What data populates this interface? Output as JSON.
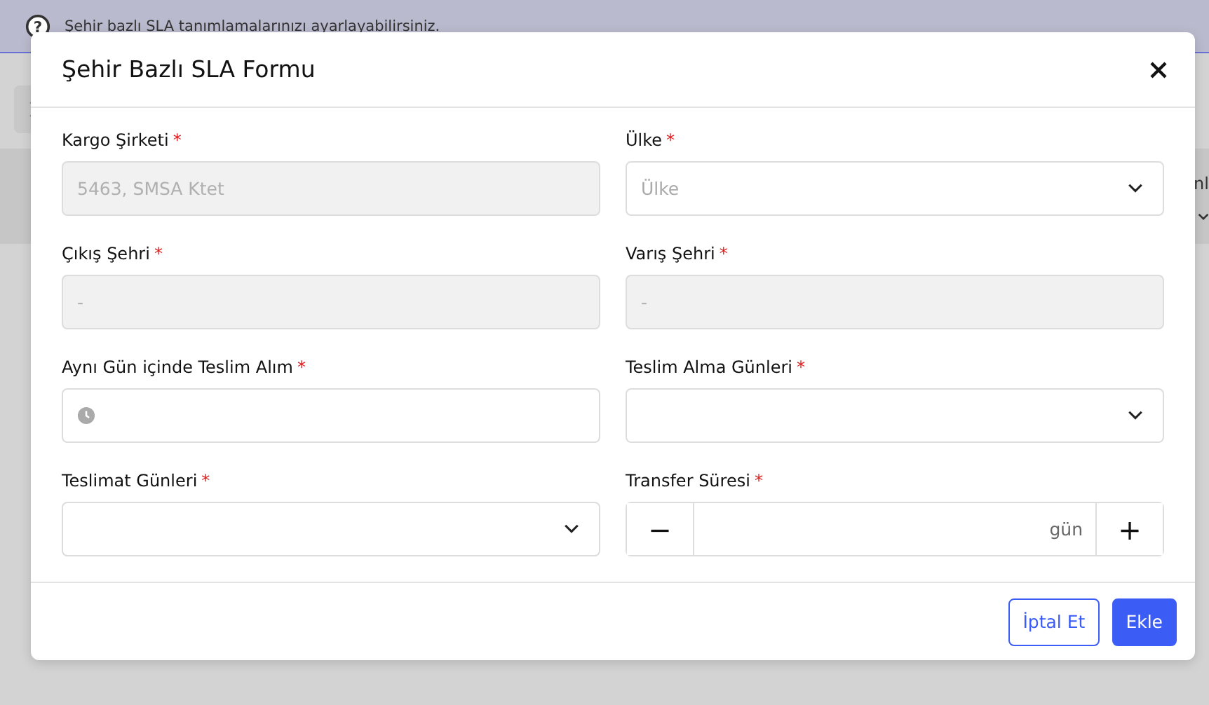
{
  "banner": {
    "icon": "?",
    "text": "Şehir bazlı SLA tanımlamalarınızı ayarlayabilirsiniz."
  },
  "background_fragment": "nl",
  "modal": {
    "title": "Şehir Bazlı SLA Formu",
    "required_mark": "*",
    "fields": [
      {
        "label": "Kargo Şirketi",
        "required": true,
        "kind": "text",
        "disabled": true,
        "value": "5463, SMSA Ktet"
      },
      {
        "label": "Ülke",
        "required": true,
        "kind": "select",
        "disabled": false,
        "placeholder": "Ülke"
      },
      {
        "label": "Çıkış Şehri",
        "required": true,
        "kind": "text",
        "disabled": true,
        "value": "-"
      },
      {
        "label": "Varış Şehri",
        "required": true,
        "kind": "text",
        "disabled": true,
        "value": "-"
      },
      {
        "label": "Aynı Gün içinde Teslim Alım",
        "required": true,
        "kind": "time",
        "disabled": false
      },
      {
        "label": "Teslim Alma Günleri",
        "required": true,
        "kind": "select",
        "disabled": false
      },
      {
        "label": "Teslimat Günleri",
        "required": true,
        "kind": "select",
        "disabled": false
      },
      {
        "label": "Transfer Süresi",
        "required": true,
        "kind": "stepper",
        "disabled": false,
        "unit": "gün",
        "minus": "−",
        "plus": "+"
      }
    ],
    "buttons": [
      {
        "label": "İptal Et",
        "kind": "secondary"
      },
      {
        "label": "Ekle",
        "kind": "primary"
      }
    ]
  }
}
